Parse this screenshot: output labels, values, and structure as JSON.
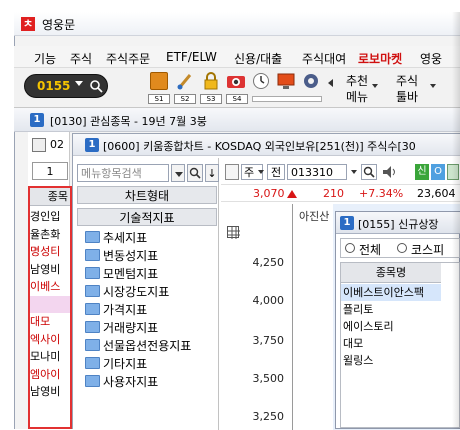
{
  "app": {
    "title": "영웅문"
  },
  "menu": [
    "기능",
    "주식",
    "주식주문",
    "ETF/ELW",
    "신용/대출",
    "주식대여",
    "로보마켓",
    "영웅"
  ],
  "toolbar": {
    "code": "0155",
    "slot_labels": [
      "S1",
      "S2",
      "S3",
      "S4"
    ],
    "recommend_menu": [
      "추천",
      "메뉴"
    ],
    "stock_toolbar": [
      "주식",
      "툴바"
    ]
  },
  "mdi_title_1": "[0130] 관심종목 - 19년 7월 3붕",
  "mdi_title_1_num": "1",
  "watch": {
    "tab_num": "1",
    "header": "종목",
    "rows": [
      "경인입",
      "율촌화",
      "명성티",
      "남영비",
      "이베스",
      "",
      "대모",
      "엑사이",
      "모나미",
      "엠아이",
      "남영비"
    ],
    "rowcolors": [
      "#000000",
      "#000000",
      "#cc0000",
      "#000000",
      "#cc0000",
      "#000000",
      "#cc0000",
      "#cc0000",
      "#000000",
      "#cc0000",
      "#000000"
    ]
  },
  "chart_window": {
    "num": "1",
    "title": "[0600] 키움종합차트 - KOSDAQ 외국인보유[251(천)] 주식수[30",
    "search_placeholder": "메뉴항목검색",
    "section_header": "차트형태",
    "section_sub": "기술적지표",
    "tree": [
      "추세지표",
      "변동성지표",
      "모멘텀지표",
      "시장강도지표",
      "가격지표",
      "거래량지표",
      "선물옵션전용지표",
      "기타지표",
      "사용자지표"
    ],
    "ctrl_ju": "주",
    "ctrl_jeon": "전",
    "stock_code": "013310",
    "price": "3,070",
    "change": "210",
    "change_pct": "+7.34%",
    "volume": "23,604",
    "chart_label": "아진산",
    "badge_sin": "신",
    "badge_o": "O",
    "y_labels": [
      "4,250",
      "4,000",
      "3,750",
      "3,500",
      "3,250"
    ]
  },
  "popup": {
    "num": "1",
    "title": "[0155] 신규상장",
    "radio_all": "전체",
    "radio_kospi": "코스피",
    "header": "종목명",
    "rows": [
      "이베스트이안스팩",
      "플리토",
      "에이스토리",
      "대모",
      "윌링스"
    ]
  }
}
